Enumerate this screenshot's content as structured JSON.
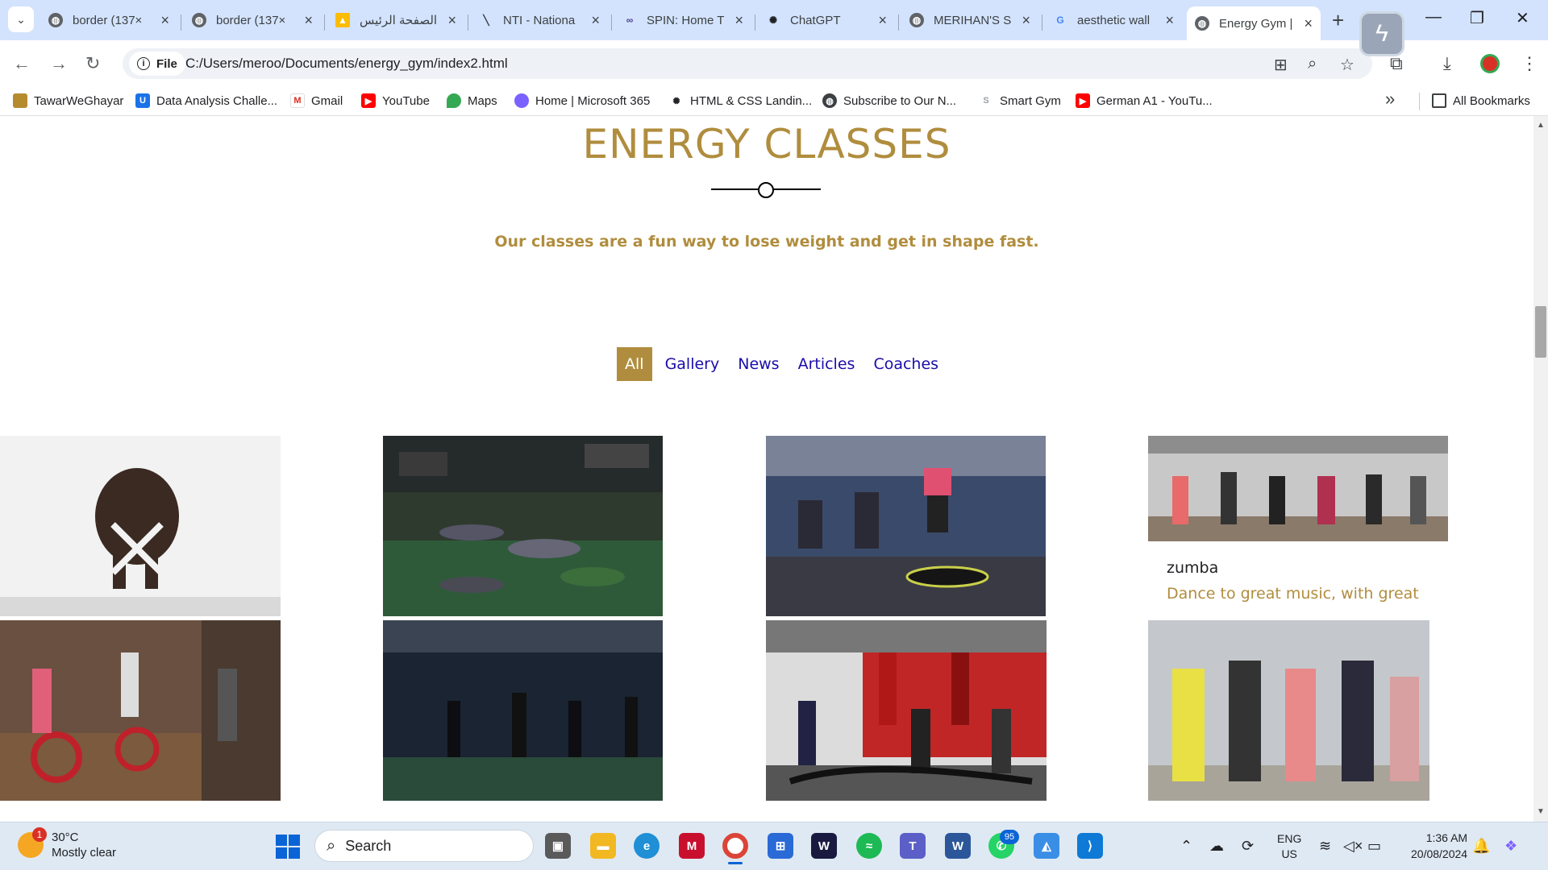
{
  "browser": {
    "tabs": [
      {
        "label": "border (137×",
        "icon": "globe",
        "favcolor": "#5f6368"
      },
      {
        "label": "border (137×",
        "icon": "globe",
        "favcolor": "#5f6368"
      },
      {
        "label": "الصفحة الرئيس",
        "icon": "drive",
        "favcolor": "#34a853"
      },
      {
        "label": "NTI - Nationa",
        "icon": "nti",
        "favcolor": "#3c4043"
      },
      {
        "label": "SPIN: Home T",
        "icon": "spin",
        "favcolor": "#4a3f8f"
      },
      {
        "label": "ChatGPT",
        "icon": "chatgpt",
        "favcolor": "#202124"
      },
      {
        "label": "MERIHAN'S S",
        "icon": "globe",
        "favcolor": "#5f6368"
      },
      {
        "label": "aesthetic wall",
        "icon": "google",
        "favcolor": "#4285f4"
      },
      {
        "label": "Energy Gym |",
        "icon": "globe",
        "favcolor": "#5f6368",
        "active": true
      }
    ],
    "address": {
      "chip": "File",
      "url": "C:/Users/meroo/Documents/energy_gym/index2.html"
    },
    "bookmarks": [
      {
        "label": "TawarWeGhayar",
        "color": "#b58b2d"
      },
      {
        "label": "Data Analysis Challe...",
        "color": "#1a73e8"
      },
      {
        "label": "Gmail",
        "color": "#d93025"
      },
      {
        "label": "YouTube",
        "color": "#ff0000"
      },
      {
        "label": "Maps",
        "color": "#34a853"
      },
      {
        "label": "Home | Microsoft 365",
        "color": "#7b61ff"
      },
      {
        "label": "HTML & CSS Landin...",
        "color": "#202124"
      },
      {
        "label": "Subscribe to Our N...",
        "color": "#3c4043"
      },
      {
        "label": "Smart Gym",
        "color": "#9aa0a6"
      },
      {
        "label": "German A1 - YouTu...",
        "color": "#ff0000"
      }
    ],
    "all_bookmarks": "All Bookmarks"
  },
  "page": {
    "title": "ENERGY CLASSES",
    "subtitle": "Our classes are a fun way to lose weight and get in shape fast.",
    "filters": [
      "All",
      "Gallery",
      "News",
      "Articles",
      "Coaches"
    ],
    "active_filter": "All",
    "accent": "#b08d3e",
    "link_color": "#1a0dab",
    "cards": [
      {
        "name": "yoga-photo"
      },
      {
        "name": "crossfit-situps-photo"
      },
      {
        "name": "trampoline-class-photo"
      },
      {
        "name": "zumba-photo",
        "label": "zumba",
        "desc": "Dance to great music, with great"
      },
      {
        "name": "spinning-class-photo"
      },
      {
        "name": "functional-training-photo"
      },
      {
        "name": "boxing-gym-photo"
      },
      {
        "name": "kickboxing-class-photo"
      }
    ]
  },
  "taskbar": {
    "weather": {
      "temp": "30°C",
      "condition": "Mostly clear",
      "badge": "1"
    },
    "search_placeholder": "Search",
    "whatsapp_badge": "95",
    "lang": {
      "line1": "ENG",
      "line2": "US"
    },
    "clock": {
      "time": "1:36 AM",
      "date": "20/08/2024"
    }
  }
}
